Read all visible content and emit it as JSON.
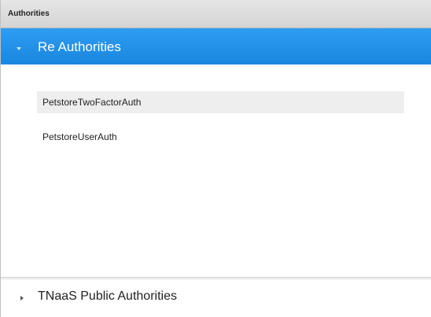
{
  "panel": {
    "title": "Authorities"
  },
  "sections": [
    {
      "title": "Re Authorities",
      "expanded": true,
      "items": [
        {
          "label": "PetstoreTwoFactorAuth",
          "selected": true
        },
        {
          "label": "PetstoreUserAuth",
          "selected": false
        }
      ]
    },
    {
      "title": "TNaaS Public Authorities",
      "expanded": false
    }
  ],
  "colors": {
    "accent": "#1e8fe6",
    "header_bg": "#dcdcdc",
    "selected_row": "#eeeeee"
  },
  "icons": {
    "expanded": "caret-down-icon",
    "collapsed": "caret-right-icon"
  }
}
